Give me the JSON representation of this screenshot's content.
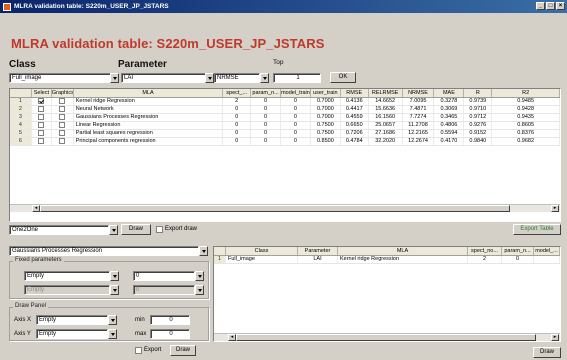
{
  "window": {
    "title": "MLRA validation table: S220m_USER_JP_JSTARS",
    "minimize": "_",
    "maximize": "□",
    "close": "×"
  },
  "heading": "MLRA validation table: S220m_USER_JP_JSTARS",
  "controls": {
    "class_label": "Class",
    "parameter_label": "Parameter",
    "top_label": "Top",
    "class_value": "Full_image",
    "parameter_value": "LAI",
    "metric_value": "NRMSE",
    "top_value": "1",
    "ok_label": "OK"
  },
  "results_table": {
    "columns": [
      "",
      "Select",
      "Graphics",
      "MLA",
      "spect_...",
      "param_n...",
      "model_train",
      "user_train",
      "RMSE",
      "RELRMSE",
      "NRMSE",
      "MAE",
      "R",
      "R2"
    ],
    "rows": [
      {
        "n": "1",
        "select": true,
        "graphics": false,
        "mla": "Kernel ridge Regression",
        "spect": "2",
        "param": "0",
        "model_train": "0",
        "user_train": "0.7000",
        "rmse": "0.4136",
        "relrmse": "14.6652",
        "nrmse": "7.0095",
        "mae": "0.3278",
        "r": "0.9739",
        "r2": "0.9485"
      },
      {
        "n": "2",
        "select": false,
        "graphics": false,
        "mla": "Neural Network",
        "spect": "0",
        "param": "0",
        "model_train": "0",
        "user_train": "0.7000",
        "rmse": "0.4417",
        "relrmse": "15.6636",
        "nrmse": "7.4871",
        "mae": "0.3069",
        "r": "0.9710",
        "r2": "0.9428"
      },
      {
        "n": "3",
        "select": false,
        "graphics": false,
        "mla": "Gaussians Processes Regression",
        "spect": "0",
        "param": "0",
        "model_train": "0",
        "user_train": "0.7000",
        "rmse": "0.4559",
        "relrmse": "16.1560",
        "nrmse": "7.7274",
        "mae": "0.3465",
        "r": "0.9712",
        "r2": "0.9435"
      },
      {
        "n": "4",
        "select": false,
        "graphics": false,
        "mla": "Linear Regression",
        "spect": "0",
        "param": "0",
        "model_train": "0",
        "user_train": "0.7500",
        "rmse": "0.6650",
        "relrmse": "25.0657",
        "nrmse": "11.2708",
        "mae": "0.4806",
        "r": "0.9276",
        "r2": "0.8605"
      },
      {
        "n": "5",
        "select": false,
        "graphics": false,
        "mla": "Partial least squares regression",
        "spect": "0",
        "param": "0",
        "model_train": "0",
        "user_train": "0.7500",
        "rmse": "0.7206",
        "relrmse": "27.1686",
        "nrmse": "12.2165",
        "mae": "0.5594",
        "r": "0.9152",
        "r2": "0.8376"
      },
      {
        "n": "6",
        "select": false,
        "graphics": false,
        "mla": "Principal components regression",
        "spect": "0",
        "param": "0",
        "model_train": "0",
        "user_train": "0.8500",
        "rmse": "0.4784",
        "relrmse": "32.2020",
        "nrmse": "12.2674",
        "mae": "0.4170",
        "r": "0.9840",
        "r2": "0.9682"
      }
    ]
  },
  "draw_bar": {
    "mode_value": "One2One",
    "draw_label": "Draw",
    "export_draw_label": "Export draw",
    "export_table_label": "Export Table"
  },
  "left_panel": {
    "model_value": "Gaussians Processes Regression",
    "fixed_params_label": "Fixed parameters",
    "fixed1_value": "Empty",
    "fixed1b_value": "0",
    "fixed2_value": "Empty",
    "fixed2b_value": "0",
    "draw_panel_label": "Draw Panel",
    "axis_x_label": "Axis X",
    "axis_x_value": "Empty",
    "axis_y_label": "Axis Y",
    "axis_y_value": "Empty",
    "min_label": "min",
    "max_label": "max",
    "min_value": "0",
    "max_value": "0",
    "export_label": "Export",
    "draw_label": "Draw"
  },
  "detail_table": {
    "columns": [
      "",
      "Class",
      "Parameter",
      "MLA",
      "spect_no...",
      "param_n...",
      "model_..."
    ],
    "rows": [
      {
        "n": "1",
        "class": "Full_image",
        "parameter": "LAI",
        "mla": "Kernel ridge Regression",
        "spect": "2",
        "param": "0",
        "model": ""
      }
    ]
  },
  "bottom_draw_label": "Draw"
}
